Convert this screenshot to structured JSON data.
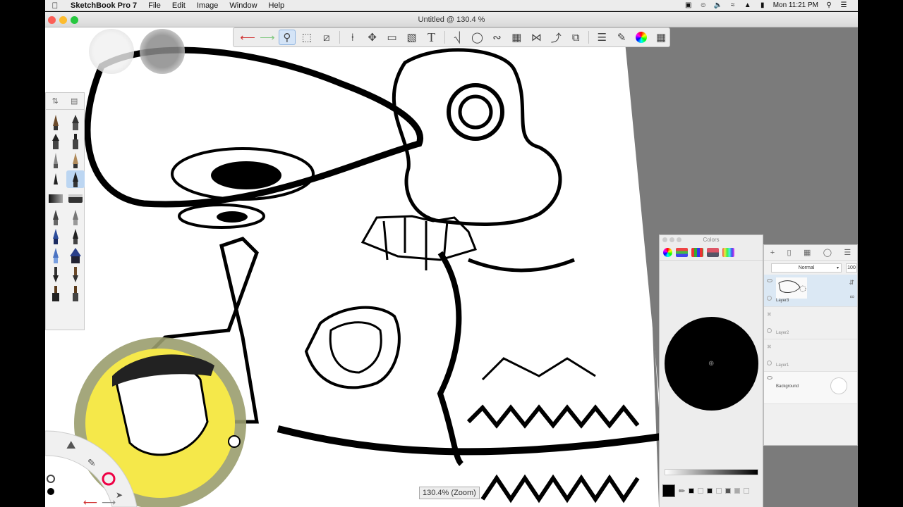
{
  "menubar": {
    "app_name": "SketchBook Pro 7",
    "menus": [
      "File",
      "Edit",
      "Image",
      "Window",
      "Help"
    ],
    "clock": "Mon 11:21 PM"
  },
  "window": {
    "title": "Untitled @ 130.4 %"
  },
  "toolbar": {
    "tools": [
      "undo-icon",
      "redo-icon",
      "zoom-tool-icon",
      "select-icon",
      "lasso-icon",
      "crop-icon",
      "transform-icon",
      "distort-icon",
      "fill-icon",
      "text-icon",
      "ruler-icon",
      "ellipse-icon",
      "french-curve-icon",
      "perspective-icon",
      "symmetry-icon",
      "stroke-icon",
      "layers-toggle-icon",
      "brushes-toggle-icon",
      "color-wheel-icon",
      "copic-icon"
    ]
  },
  "colors_panel": {
    "title": "Colors",
    "current_color": "#000000"
  },
  "layers_panel": {
    "blend_mode": "Normal",
    "opacity": "100",
    "layers": [
      "Layer3",
      "Layer2",
      "Layer1",
      "Background"
    ]
  },
  "zoom_readout": "130.4% (Zoom)",
  "colors": {
    "watermark_yellow": "#f5e84a",
    "watermark_ring": "#9a9d6e",
    "toolbar_active": "#d4e4f7",
    "undo_red": "#d03030",
    "redo_green": "#7ec87e"
  }
}
